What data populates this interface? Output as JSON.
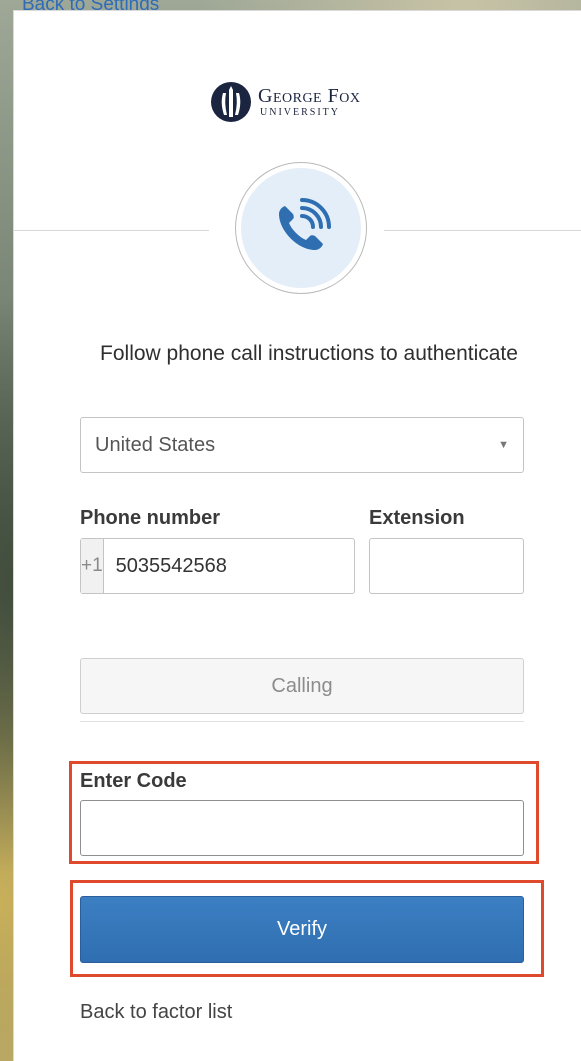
{
  "colors": {
    "accent": "#2f6fb1",
    "highlight": "#e04a2c",
    "link": "#2e6cb8",
    "icon_blue": "#2f6fb1"
  },
  "nav": {
    "back_to_settings": "Back to Settings"
  },
  "brand": {
    "name_top": "George Fox",
    "name_bottom": "UNIVERSITY",
    "icon": "george-fox-logo"
  },
  "factor": {
    "icon": "phone-call-icon",
    "title": "Follow phone call instructions to authenticate"
  },
  "form": {
    "country": {
      "selected": "United States",
      "icon": "chevron-down-icon"
    },
    "phone": {
      "label": "Phone number",
      "prefix": "+1",
      "value": "5035542568"
    },
    "extension": {
      "label": "Extension",
      "value": ""
    },
    "call_button": "Calling",
    "code": {
      "label": "Enter Code",
      "value": ""
    },
    "verify_button": "Verify"
  },
  "footer": {
    "back_to_factor_list": "Back to factor list"
  }
}
